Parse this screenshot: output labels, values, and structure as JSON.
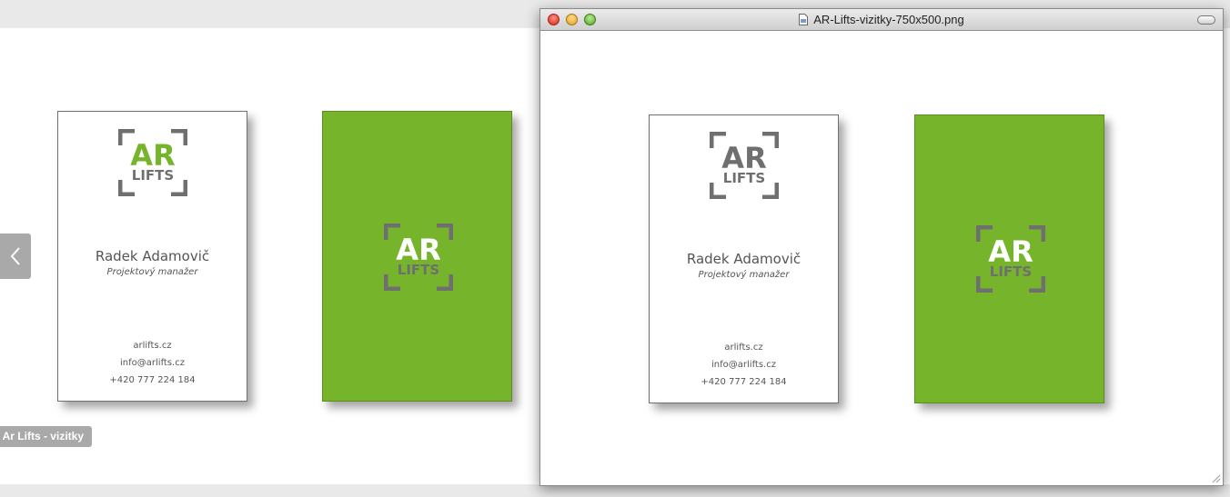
{
  "page": {
    "caption": "Ar Lifts - vizitky",
    "prev_icon": "chevron-left-icon"
  },
  "cards": {
    "logo_top": "AR",
    "logo_bottom": "LIFTS",
    "name": "Radek Adamovič",
    "role": "Projektový manažer",
    "web": "arlifts.cz",
    "email": "info@arlifts.cz",
    "phone": "+420 777 224 184"
  },
  "window": {
    "title": "AR-Lifts-vizitky-750x500.png",
    "file_icon": "image-file-icon"
  },
  "colors": {
    "brand_green": "#76b52b",
    "logo_gray": "#6f6f6f"
  }
}
